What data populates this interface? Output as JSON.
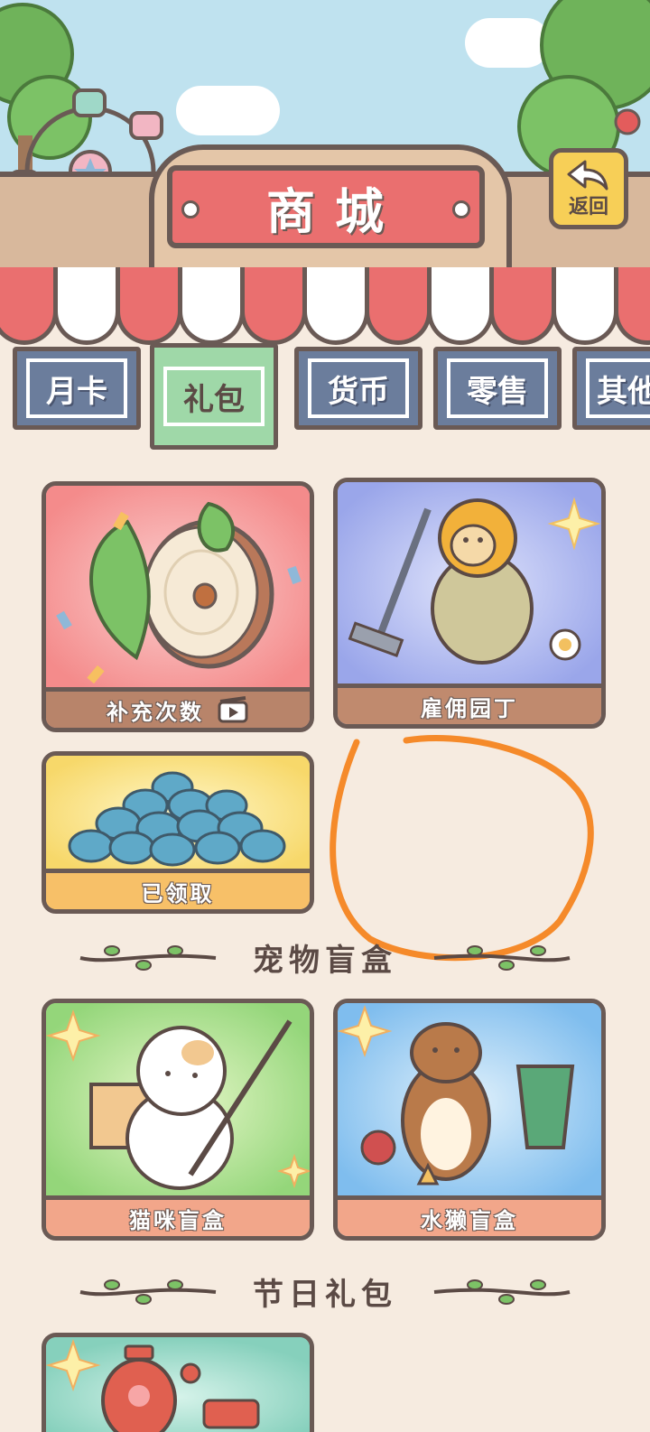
{
  "header": {
    "title": "商城",
    "back_label": "返回"
  },
  "tabs": [
    {
      "label": "月卡",
      "active": false
    },
    {
      "label": "礼包",
      "active": true
    },
    {
      "label": "货币",
      "active": false
    },
    {
      "label": "零售",
      "active": false
    },
    {
      "label": "其他",
      "active": false
    }
  ],
  "gift_cards": [
    {
      "label": "补充次数",
      "icon": "video-ad-icon"
    },
    {
      "label": "雇佣园丁"
    },
    {
      "label": "已领取"
    }
  ],
  "sections": {
    "pet_blind_box": {
      "title": "宠物盲盒",
      "cards": [
        {
          "label": "猫咪盲盒"
        },
        {
          "label": "水獭盲盒"
        }
      ]
    },
    "festival_packs": {
      "title": "节日礼包"
    }
  },
  "colors": {
    "accent_red": "#ea6f6f",
    "tab_blue": "#6b7d9c",
    "tab_active": "#9fd8a8",
    "annotation_orange": "#f58a2a"
  }
}
